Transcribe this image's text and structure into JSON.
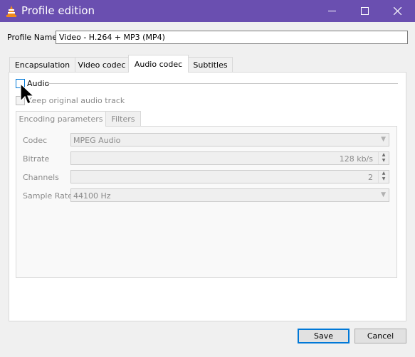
{
  "window": {
    "title": "Profile edition",
    "titlebar_color": "#6a4fb0",
    "app_icon": "vlc-cone-icon",
    "minimize_icon": "minimize-icon",
    "maximize_icon": "maximize-icon",
    "close_icon": "close-icon"
  },
  "profile": {
    "label": "Profile Name",
    "value": "Video - H.264 + MP3 (MP4)"
  },
  "tabs": [
    {
      "label": "Encapsulation"
    },
    {
      "label": "Video codec"
    },
    {
      "label": "Audio codec",
      "active": true
    },
    {
      "label": "Subtitles"
    }
  ],
  "audio": {
    "enable_label": "Audio",
    "enabled": false,
    "keep_original_label": "Keep original audio track",
    "subtabs": [
      {
        "label": "Encoding parameters",
        "active": true
      },
      {
        "label": "Filters"
      }
    ],
    "fields": {
      "codec": {
        "label": "Codec",
        "value": "MPEG Audio"
      },
      "bitrate": {
        "label": "Bitrate",
        "value": "128 kb/s"
      },
      "channels": {
        "label": "Channels",
        "value": "2"
      },
      "sample_rate": {
        "label": "Sample Rate",
        "value": "44100 Hz"
      }
    }
  },
  "buttons": {
    "save": "Save",
    "cancel": "Cancel"
  },
  "colors": {
    "accent": "#0078d7",
    "disabled_text": "#8a8a8a"
  }
}
